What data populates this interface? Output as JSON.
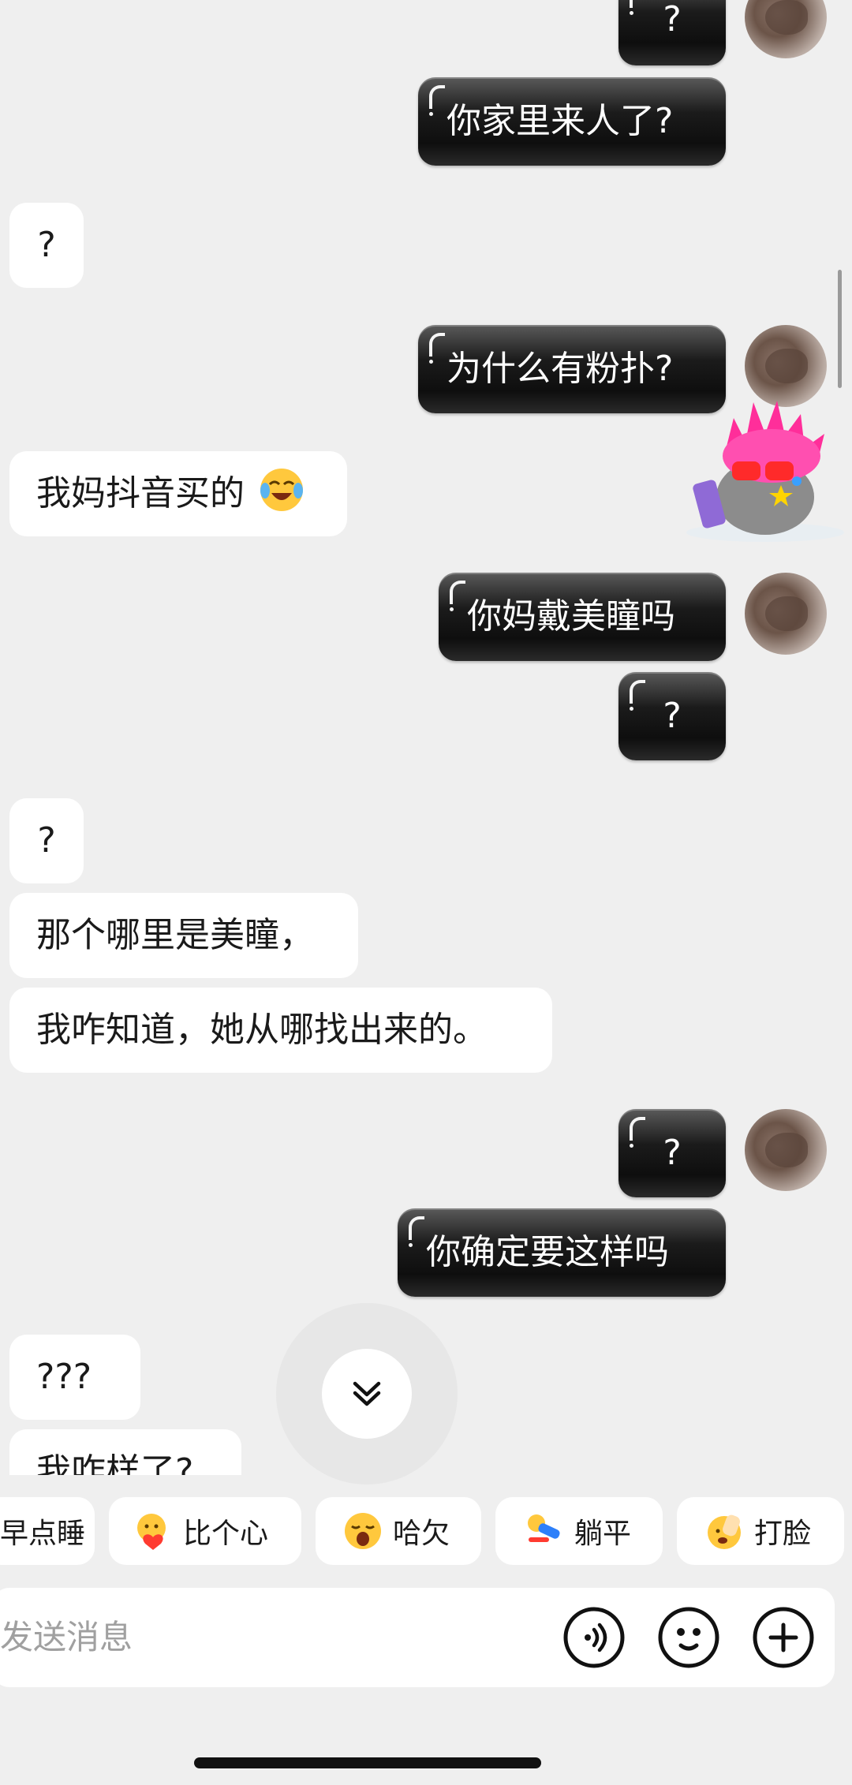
{
  "messages": [
    {
      "side": "out",
      "text": "?"
    },
    {
      "side": "out",
      "text": "你家里来人了?"
    },
    {
      "side": "in",
      "text": "?"
    },
    {
      "side": "out",
      "text": "为什么有粉扑?"
    },
    {
      "side": "in",
      "text": "我妈抖音买的"
    },
    {
      "side": "out",
      "text": "你妈戴美瞳吗"
    },
    {
      "side": "out",
      "text": "?"
    },
    {
      "side": "in",
      "text": "?"
    },
    {
      "side": "in",
      "text": "那个哪里是美瞳，"
    },
    {
      "side": "in",
      "text": "我咋知道，她从哪找出来的。"
    },
    {
      "side": "out",
      "text": "?"
    },
    {
      "side": "out",
      "text": "你确定要这样吗"
    },
    {
      "side": "in",
      "text": "???"
    },
    {
      "side": "in",
      "text": "我咋样了?"
    }
  ],
  "quick_replies": [
    {
      "label": "早点睡",
      "icon": "sleep-emoji-icon"
    },
    {
      "label": "比个心",
      "icon": "heart-hands-emoji-icon"
    },
    {
      "label": "哈欠",
      "icon": "yawn-emoji-icon"
    },
    {
      "label": "躺平",
      "icon": "lie-flat-emoji-icon"
    },
    {
      "label": "打脸",
      "icon": "face-slap-emoji-icon"
    }
  ],
  "input": {
    "placeholder": "发送消息"
  },
  "colors": {
    "background": "#efefef",
    "incoming_bubble": "#ffffff",
    "outgoing_bubble": "#1b1b1b"
  }
}
